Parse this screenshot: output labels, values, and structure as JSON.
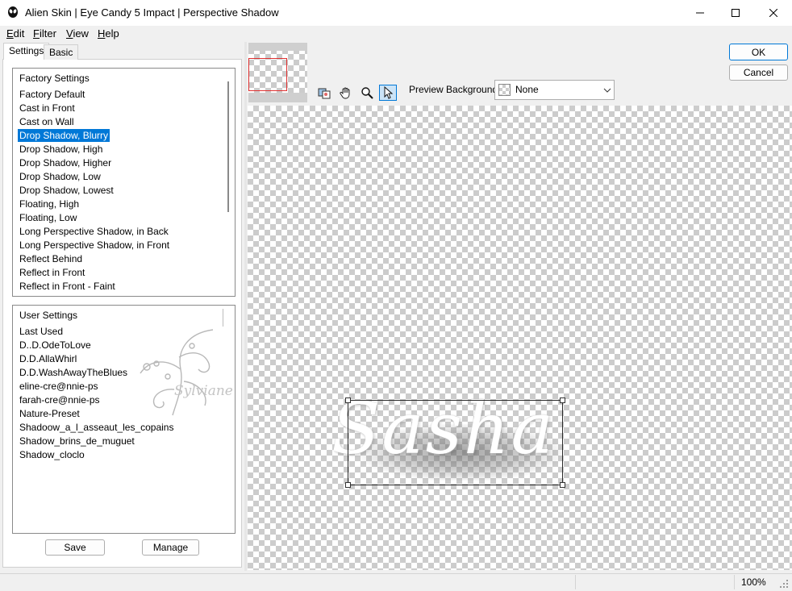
{
  "window": {
    "title": "Alien Skin | Eye Candy 5 Impact | Perspective Shadow"
  },
  "menu": {
    "items": [
      {
        "accel": "E",
        "rest": "dit"
      },
      {
        "accel": "F",
        "rest": "ilter"
      },
      {
        "accel": "V",
        "rest": "iew"
      },
      {
        "accel": "H",
        "rest": "elp"
      }
    ]
  },
  "tabs": {
    "settings": "Settings",
    "basic": "Basic"
  },
  "factory": {
    "header": "Factory Settings",
    "items": [
      "Factory Default",
      "Cast in Front",
      "Cast on Wall",
      "Drop Shadow, Blurry",
      "Drop Shadow, High",
      "Drop Shadow, Higher",
      "Drop Shadow, Low",
      "Drop Shadow, Lowest",
      "Floating, High",
      "Floating, Low",
      "Long Perspective Shadow, in Back",
      "Long Perspective Shadow, in Front",
      "Reflect Behind",
      "Reflect in Front",
      "Reflect in Front - Faint"
    ],
    "selected_index": 3
  },
  "user": {
    "header": "User Settings",
    "items": [
      "Last Used",
      "D..D.OdeToLove",
      "D.D.AllaWhirl",
      "D.D.WashAwayTheBlues",
      "eline-cre@nnie-ps",
      "farah-cre@nnie-ps",
      "Nature-Preset",
      "Shadoow_a_l_asseaut_les_copains",
      "Shadow_brins_de_muguet",
      "Shadow_cloclo"
    ],
    "watermark": "Sylviane"
  },
  "buttons": {
    "save": "Save",
    "manage": "Manage",
    "ok": "OK",
    "cancel": "Cancel"
  },
  "preview": {
    "background_label": "Preview Background:",
    "background_value": "None",
    "text": "Sasha"
  },
  "status": {
    "zoom": "100%"
  },
  "colors": {
    "selection": "#0078d7",
    "thumbnail_frame": "#e03030"
  }
}
